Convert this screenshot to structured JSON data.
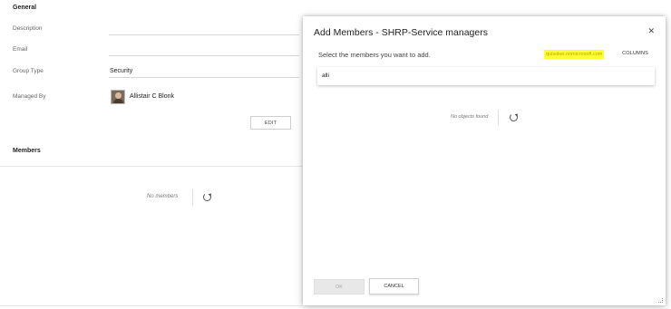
{
  "general": {
    "title": "General",
    "fields": {
      "description_label": "Description",
      "description_value": "",
      "email_label": "Email",
      "email_value": "",
      "group_type_label": "Group Type",
      "group_type_value": "Security",
      "managed_by_label": "Managed By",
      "managed_by_value": "Allistair C Blonk"
    },
    "edit_label": "EDIT"
  },
  "members": {
    "title": "Members",
    "empty_text": "No members"
  },
  "dialog": {
    "title": "Add Members - SHRP-Service managers",
    "close_glyph": "✕",
    "subtitle": "Select the members you want to add.",
    "domain": "quisoker.onmicrosoft.com",
    "columns_label": "COLUMNS",
    "search_value": "alli",
    "empty_text": "No objects found",
    "ok_label": "OK",
    "cancel_label": "CANCEL"
  },
  "icons": {
    "refresh": "refresh-icon",
    "close": "close-icon",
    "avatar": "user-avatar"
  }
}
